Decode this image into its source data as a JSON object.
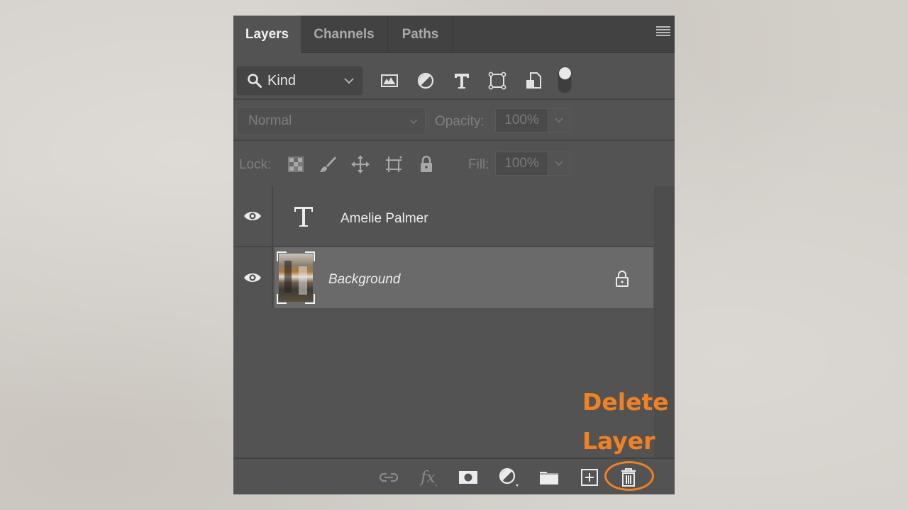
{
  "panel": {
    "tabs": [
      {
        "label": "Layers",
        "active": true
      },
      {
        "label": "Channels",
        "active": false
      },
      {
        "label": "Paths",
        "active": false
      }
    ],
    "menu_icon": "hamburger-menu-icon"
  },
  "filter": {
    "kind_label": "Kind",
    "icons": [
      "pixel-layer-filter-icon",
      "adjustment-layer-filter-icon",
      "type-layer-filter-icon",
      "shape-layer-filter-icon",
      "smart-object-filter-icon"
    ],
    "toggle_state": "on"
  },
  "blend": {
    "mode": "Normal",
    "opacity_label": "Opacity:",
    "opacity_value": "100%"
  },
  "lock": {
    "label": "Lock:",
    "icons": [
      "lock-transparent-pixels-icon",
      "lock-image-pixels-icon",
      "lock-position-icon",
      "lock-artboard-icon",
      "lock-all-icon"
    ],
    "fill_label": "Fill:",
    "fill_value": "100%"
  },
  "layers": [
    {
      "name": "Amelie Palmer",
      "type": "text",
      "visible": true,
      "selected": false,
      "locked": false
    },
    {
      "name": "Background",
      "type": "image",
      "visible": true,
      "selected": true,
      "locked": true
    }
  ],
  "bottom_toolbar": {
    "icons": [
      "link-layers-icon",
      "layer-style-fx-icon",
      "add-mask-icon",
      "new-fill-adjustment-layer-icon",
      "new-group-icon",
      "new-layer-icon",
      "delete-layer-icon"
    ]
  },
  "annotation": {
    "line1": "Delete",
    "line2": "Layer",
    "color": "#f08224"
  }
}
